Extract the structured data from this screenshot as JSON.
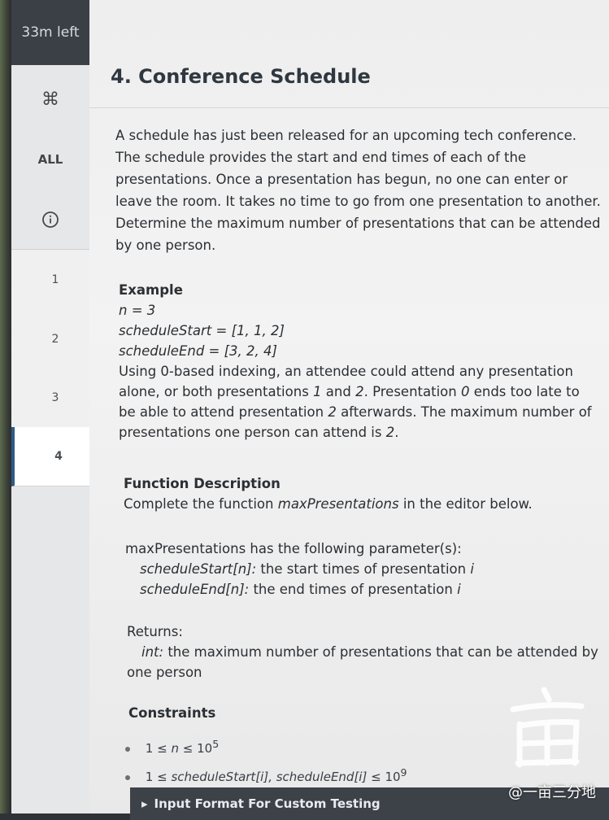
{
  "timer": "33m left",
  "sidebar": {
    "icon_top": "command-icon",
    "all_label": "ALL",
    "info_icon": "info-icon"
  },
  "questions": [
    "1",
    "2",
    "3",
    "4"
  ],
  "active_question": "4",
  "problem": {
    "title": "4. Conference Schedule",
    "description": "A schedule has just been released for an upcoming tech conference. The schedule provides the start and end times of each of the presentations. Once a presentation has begun, no one can enter or leave the room. It takes no time to go from one presentation to another. Determine the maximum number of presentations that can be attended by one person.",
    "example_heading": "Example",
    "example_lines": [
      "n = 3",
      "scheduleStart = [1, 1, 2]",
      "scheduleEnd = [3, 2, 4]"
    ],
    "example_explanation": [
      "Using 0-based indexing, an attendee could attend any presentation",
      "alone, or both presentations",
      "1",
      "and",
      "2",
      ". Presentation",
      "0",
      "ends too late to",
      "be able to attend presentation",
      "2",
      "afterwards. The maximum number of",
      "presentations one person can attend is",
      "2",
      "."
    ],
    "function_heading": "Function Description",
    "function_text_pre": "Complete the function",
    "function_name": "maxPresentations",
    "function_text_post": "in the editor below.",
    "params_intro": "maxPresentations has the following parameter(s):",
    "params": [
      {
        "name": "scheduleStart[n]:",
        "desc": "the start times of presentation",
        "var": "i"
      },
      {
        "name": "scheduleEnd[n]:",
        "desc": "the end times of presentation",
        "var": "i"
      }
    ],
    "returns_heading": "Returns:",
    "returns_type": "int:",
    "returns_desc": "the maximum number of presentations that can be attended by",
    "returns_desc2": "one person",
    "constraints_heading": "Constraints",
    "constraints": [
      {
        "pre": "1 ≤",
        "mid": "n",
        "post": "≤ 10",
        "sup": "5"
      },
      {
        "pre": "1 ≤",
        "mid": "scheduleStart[i], scheduleEnd[i]",
        "post": "≤ 10",
        "sup": "9"
      }
    ],
    "collapsible_label": "Input Format For Custom Testing"
  },
  "watermark": "@一亩三分地"
}
